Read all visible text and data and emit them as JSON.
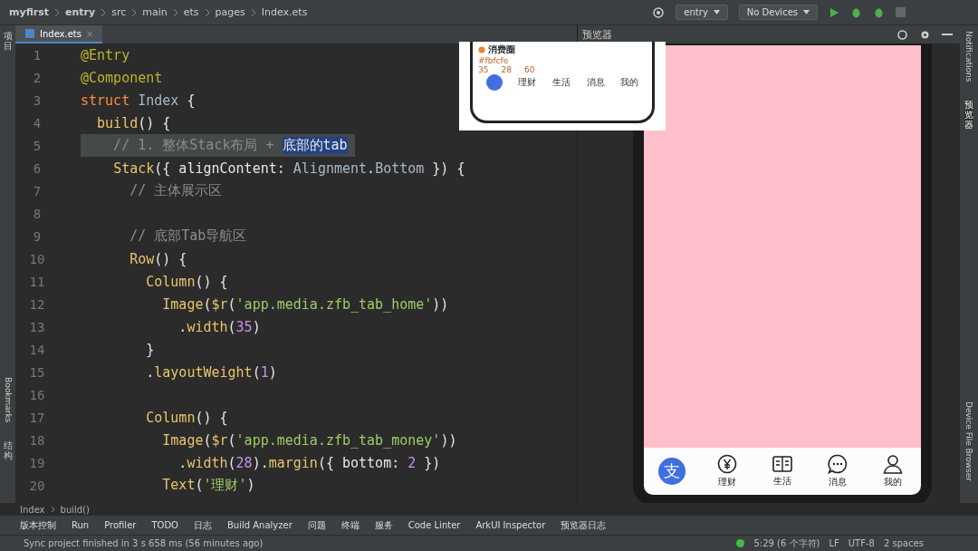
{
  "breadcrumb": [
    "myfirst",
    "entry",
    "src",
    "main",
    "ets",
    "pages",
    "Index.ets"
  ],
  "toolbar": {
    "config": "entry",
    "device": "No Devices"
  },
  "left_strip": [
    {
      "label": "项目",
      "kind": "cjk"
    },
    {
      "label": "Bookmarks",
      "kind": "latin"
    },
    {
      "label": "结构",
      "kind": "cjk"
    }
  ],
  "editor_tab": {
    "label": "Index.ets",
    "close": "×",
    "selected": true
  },
  "code": [
    {
      "n": "1",
      "current": false,
      "text": "@Entry"
    },
    {
      "n": "2",
      "current": false,
      "text": "@Component"
    },
    {
      "n": "3",
      "current": false,
      "text": "struct Index {"
    },
    {
      "n": "4",
      "current": false,
      "text": "  build() {"
    },
    {
      "n": "5",
      "current": true,
      "text": "    // 1. 整体Stack布局 + ",
      "selection": "底部的tab"
    },
    {
      "n": "6",
      "current": false,
      "text": "    Stack({ alignContent: Alignment.Bottom }) {"
    },
    {
      "n": "7",
      "current": false,
      "text": "      // 主体展示区"
    },
    {
      "n": "8",
      "current": false
    },
    {
      "n": "9",
      "current": false,
      "text": "      // 底部Tab导航区"
    },
    {
      "n": "10",
      "current": false,
      "text": "      Row() {"
    },
    {
      "n": "11",
      "current": false,
      "text": "        Column() {"
    },
    {
      "n": "12",
      "current": false,
      "text": "          Image($r('app.media.zfb_tab_home'))"
    },
    {
      "n": "13",
      "current": false,
      "text": "            .width(35)"
    },
    {
      "n": "14",
      "current": false,
      "text": "        }"
    },
    {
      "n": "15",
      "current": false,
      "text": "        .layoutWeight(1)"
    },
    {
      "n": "16",
      "current": false
    },
    {
      "n": "17",
      "current": false,
      "text": "        Column() {"
    },
    {
      "n": "18",
      "current": false,
      "text": "          Image($r('app.media.zfb_tab_money'))"
    },
    {
      "n": "19",
      "current": false,
      "text": "            .width(28).margin({ bottom: 2 })"
    },
    {
      "n": "20",
      "current": false,
      "text": "          Text('理财')"
    }
  ],
  "reference_image": {
    "section": "消费圈",
    "color_note": "#fbfcfe",
    "dims": [
      "35",
      "28",
      "60"
    ],
    "tabs": [
      "理财",
      "生活",
      "消息",
      "我的"
    ]
  },
  "preview": {
    "title": "预览器",
    "tabs": [
      {
        "kind": "logo",
        "glyph": "支"
      },
      {
        "kind": "money",
        "label": "理财"
      },
      {
        "kind": "book",
        "label": "生活"
      },
      {
        "kind": "chat",
        "label": "消息"
      },
      {
        "kind": "person",
        "label": "我的"
      }
    ]
  },
  "right_strip": [
    {
      "label": "Notifications",
      "kind": "latin",
      "selected": false
    },
    {
      "label": "预览器",
      "kind": "cjk",
      "selected": true
    },
    {
      "label": "Device File Browser",
      "kind": "latin",
      "selected": false
    }
  ],
  "code_path": [
    "Index",
    "build()"
  ],
  "tool_windows": [
    "版本控制",
    "Run",
    "Profiler",
    "TODO",
    "日志",
    "Build Analyzer",
    "问题",
    "终端",
    "服务",
    "Code Linter",
    "ArkUI Inspector",
    "预览器日志"
  ],
  "status": {
    "message": "Sync project finished in 3 s 658 ms (56 minutes ago)",
    "position": "5:29 (6 个字符)",
    "line_sep": "LF",
    "encoding": "UTF-8",
    "indent": "2 spaces"
  }
}
